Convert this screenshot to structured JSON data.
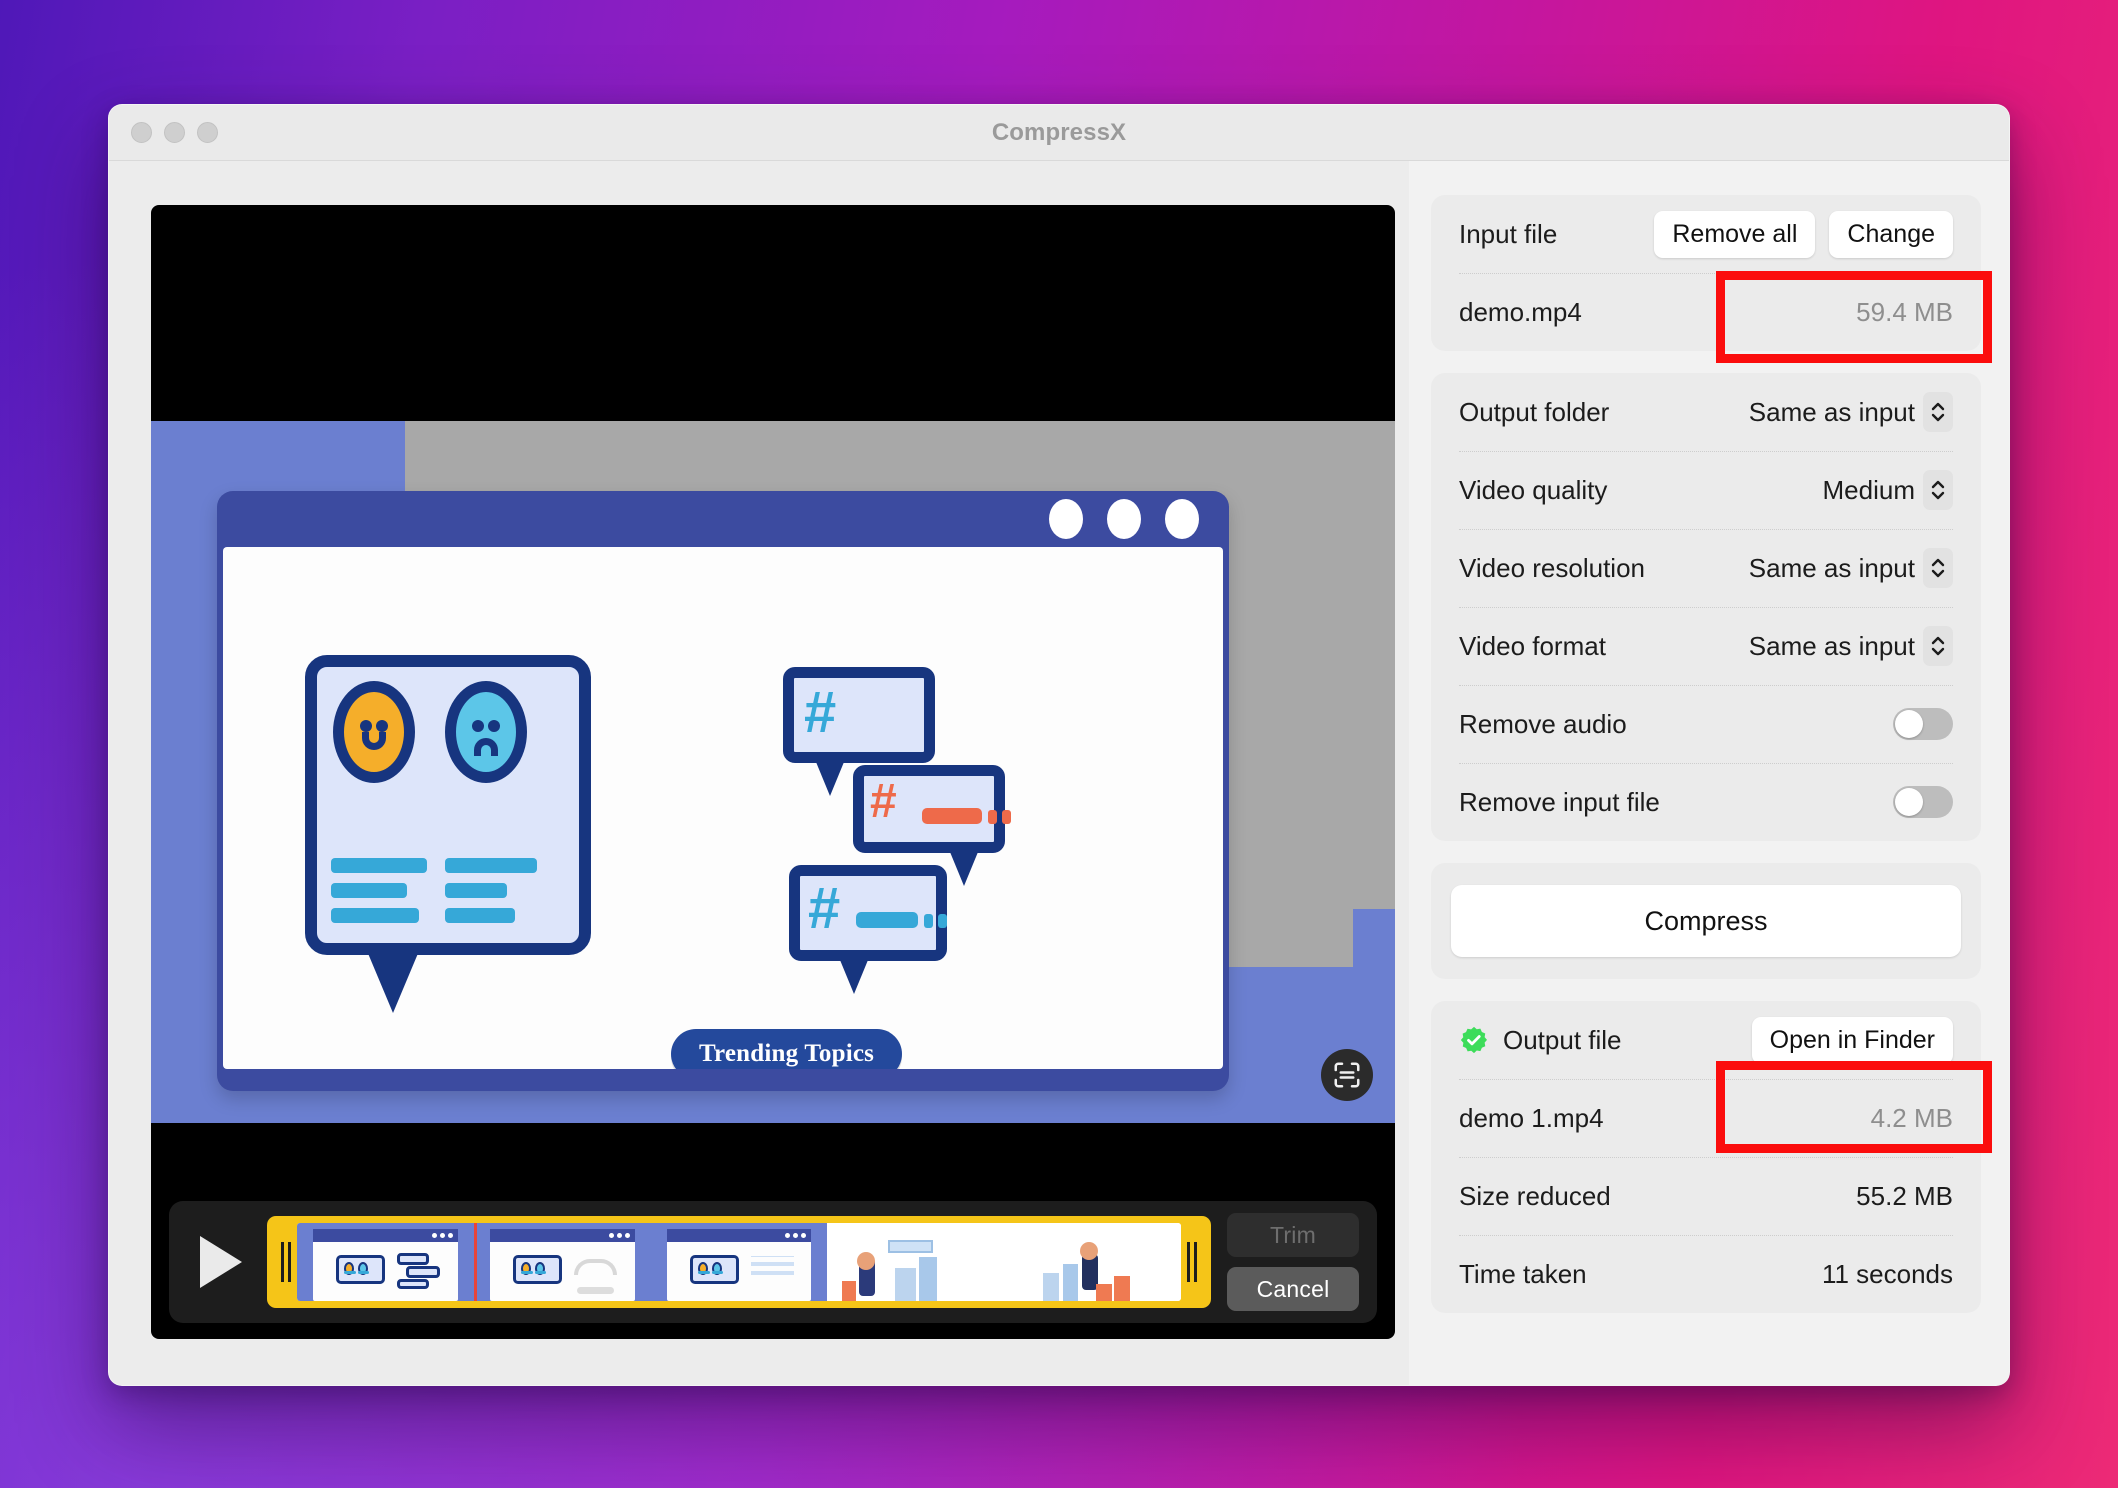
{
  "window": {
    "title": "CompressX"
  },
  "player": {
    "play_label": "play",
    "trim_label": "Trim",
    "cancel_label": "Cancel",
    "video_caption": "Trending Topics"
  },
  "sidebar": {
    "input": {
      "title": "Input file",
      "remove_all_label": "Remove all",
      "change_label": "Change",
      "file_name": "demo.mp4",
      "file_size": "59.4 MB"
    },
    "settings": [
      {
        "label": "Output folder",
        "value": "Same as input",
        "control": "stepper"
      },
      {
        "label": "Video quality",
        "value": "Medium",
        "control": "stepper"
      },
      {
        "label": "Video resolution",
        "value": "Same as input",
        "control": "stepper"
      },
      {
        "label": "Video format",
        "value": "Same as input",
        "control": "stepper"
      },
      {
        "label": "Remove audio",
        "value": "off",
        "control": "toggle"
      },
      {
        "label": "Remove input file",
        "value": "off",
        "control": "toggle"
      }
    ],
    "compress_label": "Compress",
    "output": {
      "title": "Output file",
      "open_label": "Open in Finder",
      "rows": [
        {
          "label": "demo 1.mp4",
          "value": "4.2 MB",
          "muted": true
        },
        {
          "label": "Size reduced",
          "value": "55.2 MB",
          "muted": false
        },
        {
          "label": "Time taken",
          "value": "11 seconds",
          "muted": false
        }
      ]
    }
  },
  "colors": {
    "accent_red": "#fb0d0d",
    "success_green": "#3ddc5a",
    "timeline_yellow": "#f5c518",
    "illustration_blue": "#17357f"
  }
}
